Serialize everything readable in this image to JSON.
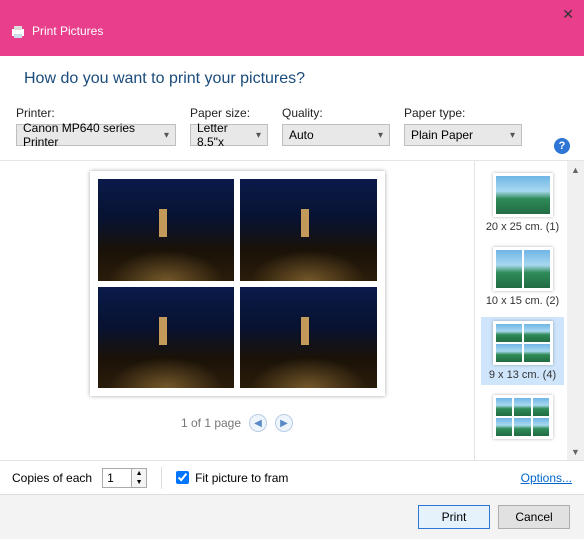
{
  "titlebar": {
    "title": "Print Pictures"
  },
  "question": "How do you want to print your pictures?",
  "controls": {
    "printer": {
      "label": "Printer:",
      "value": "Canon MP640 series Printer"
    },
    "paper_size": {
      "label": "Paper size:",
      "value": "Letter 8.5\"x"
    },
    "quality": {
      "label": "Quality:",
      "value": "Auto"
    },
    "paper_type": {
      "label": "Paper type:",
      "value": "Plain Paper"
    }
  },
  "pager": {
    "text": "1 of 1 page"
  },
  "layouts": [
    {
      "label": "20 x 25 cm. (1)",
      "grid": "g1",
      "selected": false
    },
    {
      "label": "10 x 15 cm. (2)",
      "grid": "g2",
      "selected": false
    },
    {
      "label": "9 x 13 cm. (4)",
      "grid": "g4",
      "selected": true
    },
    {
      "label": "",
      "grid": "g6",
      "selected": false
    }
  ],
  "bottom": {
    "copies_label": "Copies of each",
    "copies_value": "1",
    "fit_label": "Fit picture to fram",
    "fit_checked": true,
    "options": "Options..."
  },
  "footer": {
    "print": "Print",
    "cancel": "Cancel"
  }
}
